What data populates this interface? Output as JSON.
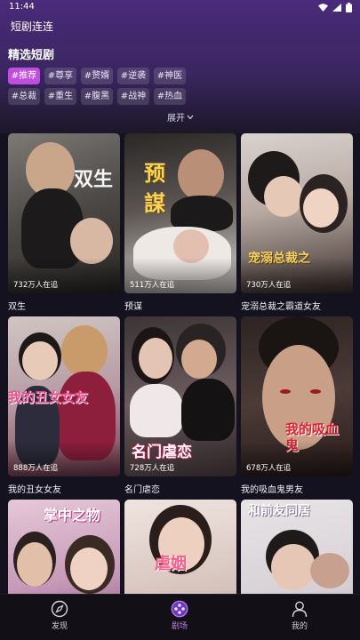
{
  "status_bar": {
    "time": "11:44"
  },
  "header": {
    "app_title": "短剧连连"
  },
  "section": {
    "title": "精选短剧",
    "expand_label": "展开"
  },
  "tags": [
    {
      "label": "#推荐",
      "active": true
    },
    {
      "label": "#尊享",
      "active": false
    },
    {
      "label": "#赘婿",
      "active": false
    },
    {
      "label": "#逆袭",
      "active": false
    },
    {
      "label": "#神医",
      "active": false
    },
    {
      "label": "#总裁",
      "active": false
    },
    {
      "label": "#重生",
      "active": false
    },
    {
      "label": "#腹黑",
      "active": false
    },
    {
      "label": "#战神",
      "active": false
    },
    {
      "label": "#热血",
      "active": false
    }
  ],
  "dramas": [
    {
      "title": "双生",
      "views": "732万人在追",
      "poster_text": "双生"
    },
    {
      "title": "预谋",
      "views": "511万人在追",
      "poster_text": "预謀"
    },
    {
      "title": "宠溺总裁之霸道女友",
      "views": "730万人在追",
      "poster_text": "宠溺总裁之"
    },
    {
      "title": "我的丑女女友",
      "views": "888万人在追",
      "poster_text": "我的丑女女友"
    },
    {
      "title": "名门虐恋",
      "views": "728万人在追",
      "poster_text": "名门虐恋"
    },
    {
      "title": "我的吸血鬼男友",
      "views": "678万人在追",
      "poster_text": "我的吸血鬼"
    },
    {
      "title": "",
      "views": "",
      "poster_text": "掌中之物"
    },
    {
      "title": "",
      "views": "",
      "poster_text": "虐姻"
    },
    {
      "title": "",
      "views": "",
      "poster_text": "和前友同居"
    }
  ],
  "bottom_nav": [
    {
      "label": "发现",
      "icon": "compass-icon",
      "active": false
    },
    {
      "label": "剧场",
      "icon": "film-reel-icon",
      "active": true
    },
    {
      "label": "我的",
      "icon": "user-icon",
      "active": false
    }
  ],
  "colors": {
    "accent": "#c24be0",
    "nav_active": "#c07bf0",
    "header_gradient_top": "#4a2a7a"
  }
}
